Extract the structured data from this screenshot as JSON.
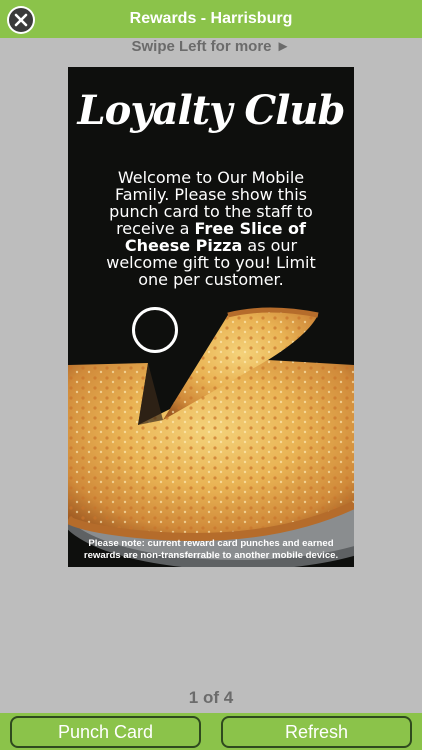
{
  "header": {
    "title": "Rewards - Harrisburg",
    "close_icon": "close-icon"
  },
  "swipe_hint": "Swipe Left for more ►",
  "card": {
    "brand": "Loyalty Club",
    "message_part1": "Welcome to Our Mobile Family. Please show this punch card to the staff to receive a ",
    "message_bold": "Free Slice of Cheese Pizza",
    "message_part2": " as our welcome gift to you! Limit one per customer.",
    "note_line1": "Please note: current reward card punches and earned",
    "note_line2": "rewards are non-transferrable to another mobile device."
  },
  "pager": "1 of 4",
  "buttons": {
    "punch_card": "Punch Card",
    "refresh": "Refresh"
  },
  "colors": {
    "accent": "#8bc34a",
    "background": "#bdbdbd",
    "card_bg": "#0e0f0d"
  }
}
